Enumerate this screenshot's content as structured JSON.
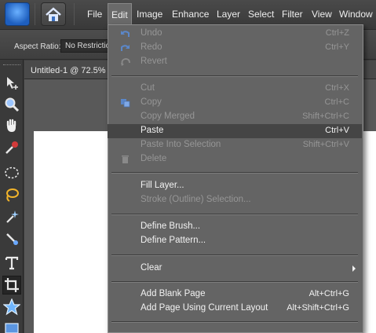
{
  "menubar": {
    "items": [
      "File",
      "Edit",
      "Image",
      "Enhance",
      "Layer",
      "Select",
      "Filter",
      "View",
      "Window"
    ],
    "active": "Edit"
  },
  "options_bar": {
    "aspect_ratio_label": "Aspect Ratio:",
    "aspect_ratio_value": "No Restriction"
  },
  "document": {
    "title": "Untitled-1 @ 72.5%"
  },
  "tools": [
    "move-icon",
    "zoom-icon",
    "hand-icon",
    "eyedropper-icon",
    "marquee-icon",
    "lasso-icon",
    "magic-wand-icon",
    "quick-selection-icon",
    "type-icon",
    "crop-icon",
    "cookie-cutter-icon",
    "straighten-icon"
  ],
  "edit_menu": {
    "items": [
      {
        "label": "Undo",
        "shortcut": "Ctrl+Z",
        "enabled": false,
        "icon": "undo-icon"
      },
      {
        "label": "Redo",
        "shortcut": "Ctrl+Y",
        "enabled": false,
        "icon": "redo-icon"
      },
      {
        "label": "Revert",
        "shortcut": "",
        "enabled": false,
        "icon": "revert-icon"
      },
      {
        "label": "Cut",
        "shortcut": "Ctrl+X",
        "enabled": false,
        "icon": ""
      },
      {
        "label": "Copy",
        "shortcut": "Ctrl+C",
        "enabled": false,
        "icon": "copy-icon"
      },
      {
        "label": "Copy Merged",
        "shortcut": "Shift+Ctrl+C",
        "enabled": false,
        "icon": ""
      },
      {
        "label": "Paste",
        "shortcut": "Ctrl+V",
        "enabled": true,
        "highlighted": true,
        "icon": ""
      },
      {
        "label": "Paste Into Selection",
        "shortcut": "Shift+Ctrl+V",
        "enabled": false,
        "icon": ""
      },
      {
        "label": "Delete",
        "shortcut": "",
        "enabled": false,
        "icon": "trash-icon"
      },
      {
        "label": "Fill Layer...",
        "shortcut": "",
        "enabled": true,
        "icon": ""
      },
      {
        "label": "Stroke (Outline) Selection...",
        "shortcut": "",
        "enabled": false,
        "icon": ""
      },
      {
        "label": "Define Brush...",
        "shortcut": "",
        "enabled": true,
        "icon": ""
      },
      {
        "label": "Define Pattern...",
        "shortcut": "",
        "enabled": true,
        "icon": ""
      },
      {
        "label": "Clear",
        "shortcut": "",
        "enabled": true,
        "submenu": true,
        "icon": ""
      },
      {
        "label": "Add Blank Page",
        "shortcut": "Alt+Ctrl+G",
        "enabled": true,
        "icon": ""
      },
      {
        "label": "Add Page Using Current Layout",
        "shortcut": "Alt+Shift+Ctrl+G",
        "enabled": true,
        "icon": ""
      }
    ]
  },
  "colors": {
    "menu_bg": "#646464",
    "highlight": "#454545",
    "enabled_text": "#f2f2f2",
    "disabled_text": "#969696"
  }
}
